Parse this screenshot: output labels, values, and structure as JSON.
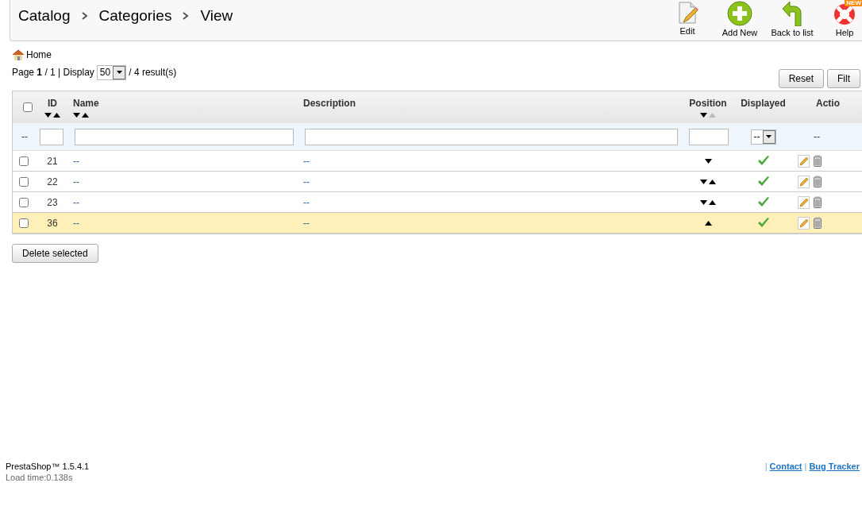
{
  "breadcrumb": [
    "Catalog",
    "Categories",
    "View"
  ],
  "toolbar": [
    {
      "label": "Edit",
      "kind": "edit"
    },
    {
      "label": "Add New",
      "kind": "add"
    },
    {
      "label": "Back to list",
      "kind": "back"
    },
    {
      "label": "Help",
      "kind": "help",
      "badge": "NEW"
    }
  ],
  "home": "Home",
  "pagination": {
    "text": "Page **1** / 1 | Display",
    "per_page": "50",
    "results": "/ 4 result(s)"
  },
  "filter_buttons": [
    "Reset",
    "Filt"
  ],
  "select_all_checked": false,
  "columns": [
    {
      "label": "ID",
      "kind": "sortable"
    },
    {
      "label": "Name",
      "kind": "sortable"
    },
    {
      "label": "Description",
      "kind": "plain"
    },
    {
      "label": "Position",
      "kind": "position"
    },
    {
      "label": "Displayed",
      "kind": "plain"
    },
    {
      "label": "Actio",
      "kind": "plain"
    }
  ],
  "filter_row": {
    "checkbox_cell": "--",
    "displayed_value": "--",
    "actions_cell": "--"
  },
  "rows": [
    {
      "id": "21",
      "name": "--",
      "description": "--",
      "move_down": true,
      "move_up": false,
      "displayed": true,
      "highlighted": false,
      "checked": false
    },
    {
      "id": "22",
      "name": "--",
      "description": "--",
      "move_down": true,
      "move_up": true,
      "displayed": true,
      "highlighted": false,
      "checked": false
    },
    {
      "id": "23",
      "name": "--",
      "description": "--",
      "move_down": true,
      "move_up": true,
      "displayed": true,
      "highlighted": false,
      "checked": false
    },
    {
      "id": "36",
      "name": "--",
      "description": "--",
      "move_down": false,
      "move_up": true,
      "displayed": true,
      "highlighted": true,
      "checked": false
    }
  ],
  "delete_button": "Delete selected",
  "footer": {
    "version": "PrestaShop™ 1.5.4.1",
    "load_time": "Load time:0.138s",
    "separator": "|",
    "links": [
      "Contact",
      "Bug Tracker"
    ]
  }
}
